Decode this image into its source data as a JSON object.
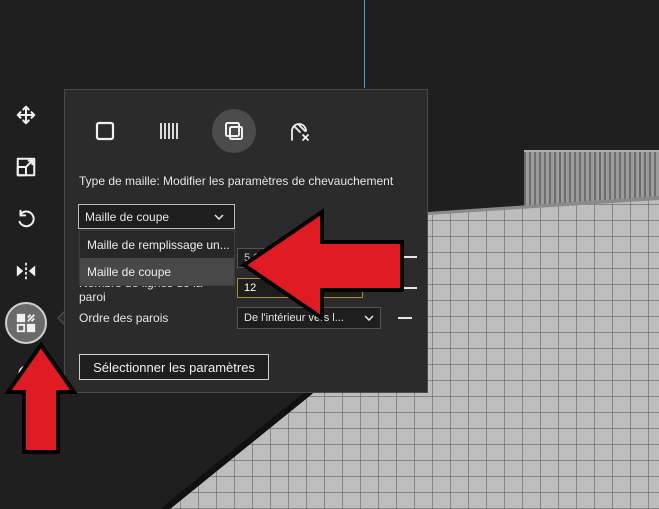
{
  "toolbar": {
    "tools": [
      {
        "icon": "move-icon"
      },
      {
        "icon": "scale-icon"
      },
      {
        "icon": "rotate-icon"
      },
      {
        "icon": "mirror-icon"
      },
      {
        "icon": "per-model-settings-icon",
        "active": true
      },
      {
        "icon": "support-blocker-icon"
      }
    ]
  },
  "panel": {
    "mesh_types": [
      {
        "icon": "normal-model-icon"
      },
      {
        "icon": "infill-mesh-icon"
      },
      {
        "icon": "cutting-mesh-icon",
        "active": true
      },
      {
        "icon": "support-blocker-mesh-icon"
      }
    ],
    "mesh_type_label": "Type de maille: Modifier les paramètres de chevauchement",
    "mesh_select": {
      "value": "Maille de coupe"
    },
    "dropdown_options": [
      "Maille de remplissage un...",
      "Maille de coupe"
    ],
    "rows": [
      {
        "label": "",
        "value": "5 0"
      },
      {
        "label": "Nombre de lignes de la paroi",
        "value": "12"
      },
      {
        "label": "Ordre des parois",
        "value": "De l'intérieur vers l..."
      }
    ],
    "select_settings_label": "Sélectionner les paramètres"
  },
  "colors": {
    "accent_arrow": "#e01b24",
    "panel_bg": "#2b2b2b"
  }
}
